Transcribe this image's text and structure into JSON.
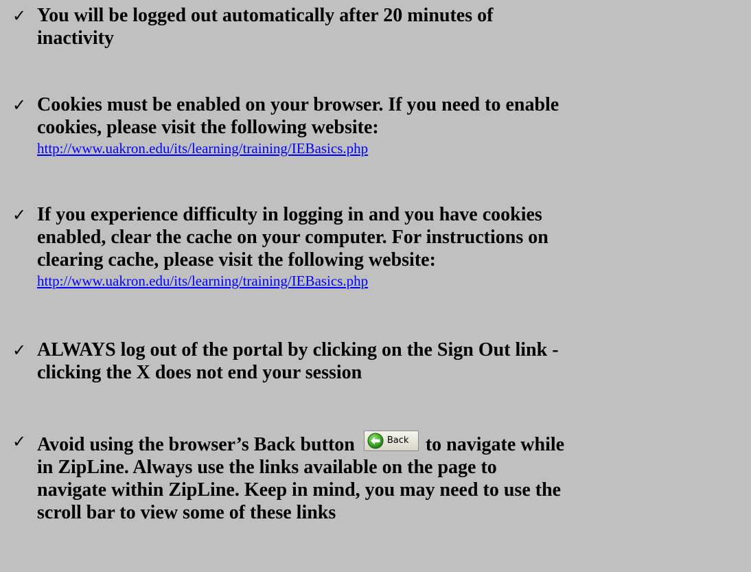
{
  "check_glyph": "✓",
  "items": [
    {
      "lines": [
        "You will be logged out automatically after 20 minutes of",
        "inactivity"
      ]
    },
    {
      "lines": [
        "Cookies must be enabled on your browser.  If you need to enable",
        "cookies, please visit the following website:"
      ],
      "url": "http://www.uakron.edu/its/learning/training/IEBasics.php"
    },
    {
      "lines": [
        "If you experience difficulty in logging in and you have cookies",
        "enabled, clear the cache on your computer.  For instructions on",
        "clearing cache, please visit the following website:"
      ],
      "url": "http://www.uakron.edu/its/learning/training/IEBasics.php"
    },
    {
      "lines": [
        "ALWAYS log out of the portal by clicking on the Sign Out link  -",
        "clicking the X does not end your session"
      ]
    },
    {
      "line1_before": "Avoid using the browser’s Back button",
      "back_button_label": "Back",
      "back_icon": "green-back-arrow-icon",
      "line1_after": "to navigate while",
      "lines": [
        "in ZipLine.  Always use the links available on the page to",
        "navigate within ZipLine.  Keep in mind, you may need to use the",
        "scroll bar to view some of these links"
      ]
    }
  ]
}
